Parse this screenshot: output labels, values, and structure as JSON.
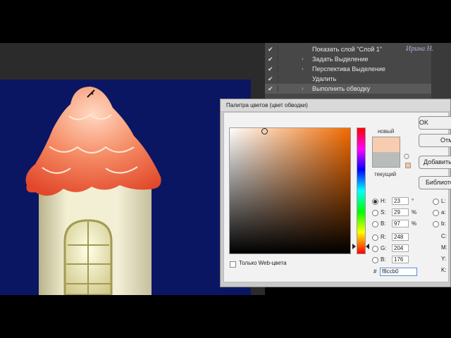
{
  "actions_panel": {
    "rows": [
      {
        "checked": "✔",
        "expand": "",
        "label": "Показать слой \"Слой 1\""
      },
      {
        "checked": "✔",
        "expand": "›",
        "label": "Задать Выделение"
      },
      {
        "checked": "✔",
        "expand": "›",
        "label": "Перспектива Выделение"
      },
      {
        "checked": "✔",
        "expand": "",
        "label": "Удалить"
      },
      {
        "checked": "✔",
        "expand": "›",
        "label": "Выполнить обводку"
      }
    ]
  },
  "watermark": {
    "text": "Ирина Н."
  },
  "color_picker": {
    "title": "Палитра цветов (цвет обводки)",
    "new_label": "новый",
    "current_label": "текущий",
    "new_color": "#f8ccb0",
    "current_color": "#b9bdb9",
    "buttons": {
      "ok": "OK",
      "cancel": "Отмена",
      "add_swatch": "Добавить в образцы",
      "libraries": "Библиотеки цветов"
    },
    "fields": {
      "h": {
        "label": "H:",
        "value": "23",
        "unit": "°"
      },
      "s": {
        "label": "S:",
        "value": "29",
        "unit": "%"
      },
      "b": {
        "label": "B:",
        "value": "97",
        "unit": "%"
      },
      "r": {
        "label": "R:",
        "value": "248"
      },
      "g": {
        "label": "G:",
        "value": "204"
      },
      "bb": {
        "label": "B:",
        "value": "176"
      }
    },
    "lab_fields": {
      "l": "L:",
      "a": "a:",
      "b": "b:"
    },
    "cmyk_fields": {
      "c": "C:",
      "m": "M:",
      "y": "Y:",
      "k": "K:"
    },
    "web_only_label": "Только Web-цвета",
    "hash": "#",
    "hex_value": "f8ccb0"
  }
}
